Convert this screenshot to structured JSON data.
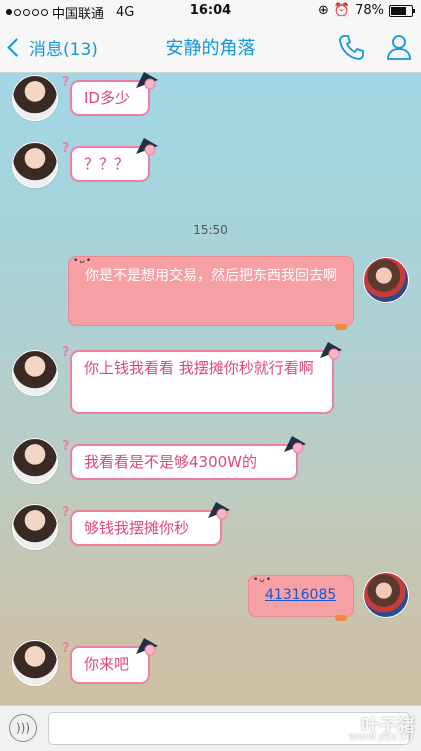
{
  "status": {
    "carrier": "中国联通",
    "network": "4G",
    "time": "16:04",
    "battery": "78%"
  },
  "nav": {
    "back_label": "消息(13)",
    "title": "安静的角落"
  },
  "divider_time": "15:50",
  "messages": [
    {
      "from": "them",
      "text": "ID多少"
    },
    {
      "from": "them",
      "text": "？？？"
    },
    {
      "from": "me",
      "text": "你是不是想用交易，然后把东西我回去啊"
    },
    {
      "from": "them",
      "text": "你上钱我看看 我摆摊你秒就行看啊"
    },
    {
      "from": "them",
      "text": "我看看是不是够4300W的"
    },
    {
      "from": "them",
      "text": "够钱我摆摊你秒"
    },
    {
      "from": "me",
      "text": "41316085"
    },
    {
      "from": "them",
      "text": "你来吧"
    }
  ],
  "watermark": {
    "main": "叶子猪",
    "sub": "www.yzz.cn"
  },
  "colors": {
    "accent": "#1296db",
    "bubble_border": "#f07ea0",
    "sent_bubble": "#f6a0a4"
  }
}
